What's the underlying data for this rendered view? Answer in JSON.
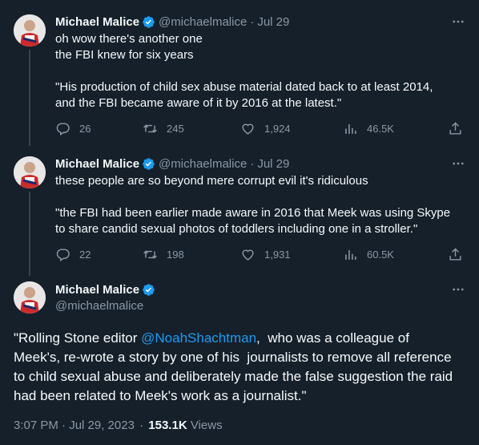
{
  "tweets": [
    {
      "name": "Michael Malice",
      "handle": "@michaelmalice",
      "date": "Jul 29",
      "text": "oh wow there's another one\nthe FBI knew for six years\n\n\"His production of child sex abuse material dated back to at least 2014,\nand the FBI became aware of it by 2016 at the latest.\"",
      "replies": "26",
      "retweets": "245",
      "likes": "1,924",
      "views": "46.5K"
    },
    {
      "name": "Michael Malice",
      "handle": "@michaelmalice",
      "date": "Jul 29",
      "text": "these people are so beyond mere corrupt evil it's ridiculous\n\n\"the FBI had been earlier made aware in 2016 that Meek was using Skype\nto share candid sexual photos of toddlers including one in a stroller.\"",
      "replies": "22",
      "retweets": "198",
      "likes": "1,931",
      "views": "60.5K"
    }
  ],
  "main_tweet": {
    "name": "Michael Malice",
    "handle": "@michaelmalice",
    "text_before": "\"Rolling Stone editor ",
    "mention": "@NoahShachtman",
    "text_after": ",  who was a colleague of\nMeek's, re-wrote a story by one of his  journalists to remove all reference\nto child sexual abuse and deliberately made the false suggestion the raid\nhad been related to Meek's work as a journalist.\"",
    "timestamp": "3:07 PM · Jul 29, 2023",
    "views_count": "153.1K",
    "views_label": "Views"
  },
  "sep": "·",
  "colors": {
    "background": "#15202b",
    "text": "#f7f9f9",
    "muted": "#8b98a5",
    "accent": "#1d9bf0"
  }
}
